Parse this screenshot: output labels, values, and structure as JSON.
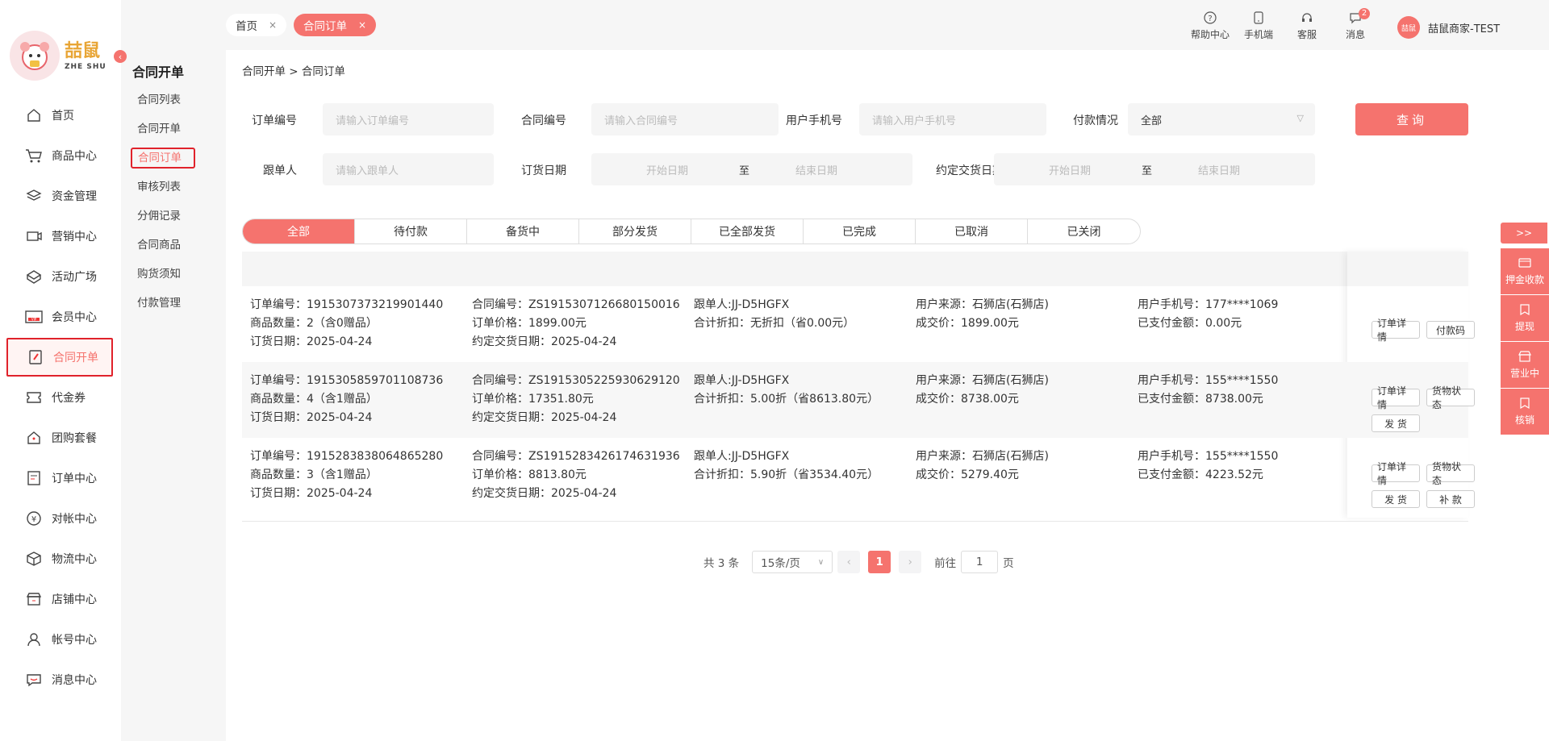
{
  "brand": {
    "name": "喆鼠",
    "sub": "ZHE SHU"
  },
  "sidebar": {
    "items": [
      {
        "label": "首页",
        "icon": "home-icon"
      },
      {
        "label": "商品中心",
        "icon": "cart-icon"
      },
      {
        "label": "资金管理",
        "icon": "layers-icon"
      },
      {
        "label": "营销中心",
        "icon": "marketing-icon"
      },
      {
        "label": "活动广场",
        "icon": "activity-icon"
      },
      {
        "label": "会员中心",
        "icon": "vip-icon"
      },
      {
        "label": "合同开单",
        "icon": "contract-icon"
      },
      {
        "label": "代金券",
        "icon": "coupon-icon"
      },
      {
        "label": "团购套餐",
        "icon": "groupbuy-icon"
      },
      {
        "label": "订单中心",
        "icon": "order-icon"
      },
      {
        "label": "对帐中心",
        "icon": "yen-icon"
      },
      {
        "label": "物流中心",
        "icon": "box-icon"
      },
      {
        "label": "店铺中心",
        "icon": "shop-icon"
      },
      {
        "label": "帐号中心",
        "icon": "user-icon"
      },
      {
        "label": "消息中心",
        "icon": "message-icon"
      }
    ]
  },
  "subnav": {
    "title": "合同开单",
    "items": [
      "合同列表",
      "合同开单",
      "合同订单",
      "审核列表",
      "分佣记录",
      "合同商品",
      "购货须知",
      "付款管理"
    ]
  },
  "tabs": {
    "home": "首页",
    "current": "合同订单",
    "close": "×"
  },
  "topicons": {
    "help": "帮助中心",
    "mobile": "手机端",
    "service": "客服",
    "message": "消息",
    "msg_count": "2"
  },
  "user": {
    "name": "喆鼠商家-TEST",
    "avatar_text": "喆鼠"
  },
  "breadcrumb": "合同开单 > 合同订单",
  "filters": {
    "order_no_label": "订单编号",
    "order_no_ph": "请输入订单编号",
    "contract_no_label": "合同编号",
    "contract_no_ph": "请输入合同编号",
    "phone_label": "用户手机号",
    "phone_ph": "请输入用户手机号",
    "pay_label": "付款情况",
    "pay_value": "全部",
    "follower_label": "跟单人",
    "follower_ph": "请输入跟单人",
    "order_date_label": "订货日期",
    "delivery_date_label": "约定交货日期",
    "start_ph": "开始日期",
    "to": "至",
    "end_ph": "结束日期",
    "query": "查询"
  },
  "status_tabs": [
    "全部",
    "待付款",
    "备货中",
    "部分发货",
    "已全部发货",
    "已完成",
    "已取消",
    "已关闭"
  ],
  "orders": [
    {
      "order_no": "订单编号：1915307373219901440",
      "qty": "商品数量：2（含0赠品）",
      "order_date": "订货日期：2025-04-24",
      "contract_no": "合同编号：ZS1915307126680150016",
      "price": "订单价格：1899.00元",
      "delivery": "约定交货日期：2025-04-24",
      "follower": "跟单人:JJ-D5HGFX",
      "discount": "合计折扣：无折扣（省0.00元）",
      "source": "用户来源：石狮店(石狮店)",
      "deal": "成交价：1899.00元",
      "phone": "用户手机号：177****1069",
      "paid": "已支付金额：0.00元",
      "actions": [
        "订单详情",
        "付款码"
      ]
    },
    {
      "order_no": "订单编号：1915305859701108736",
      "qty": "商品数量：4（含1赠品）",
      "order_date": "订货日期：2025-04-24",
      "contract_no": "合同编号：ZS1915305225930629120",
      "price": "订单价格：17351.80元",
      "delivery": "约定交货日期：2025-04-24",
      "follower": "跟单人:JJ-D5HGFX",
      "discount": "合计折扣：5.00折（省8613.80元）",
      "source": "用户来源：石狮店(石狮店)",
      "deal": "成交价：8738.00元",
      "phone": "用户手机号：155****1550",
      "paid": "已支付金额：8738.00元",
      "actions": [
        "订单详情",
        "货物状态",
        "发 货"
      ]
    },
    {
      "order_no": "订单编号：1915283838064865280",
      "qty": "商品数量：3（含1赠品）",
      "order_date": "订货日期：2025-04-24",
      "contract_no": "合同编号：ZS1915283426174631936",
      "price": "订单价格：8813.80元",
      "delivery": "约定交货日期：2025-04-24",
      "follower": "跟单人:JJ-D5HGFX",
      "discount": "合计折扣：5.90折（省3534.40元）",
      "source": "用户来源：石狮店(石狮店)",
      "deal": "成交价：5279.40元",
      "phone": "用户手机号：155****1550",
      "paid": "已支付金额：4223.52元",
      "actions": [
        "订单详情",
        "货物状态",
        "发 货",
        "补 款"
      ]
    }
  ],
  "pager": {
    "total": "共 3 条",
    "size": "15条/页",
    "page": "1",
    "goto": "前往",
    "goto_value": "1",
    "page_unit": "页"
  },
  "rail": {
    "toggle": ">>",
    "items": [
      "押金收款",
      "提现",
      "营业中",
      "核销"
    ]
  },
  "colors": {
    "accent": "#f5736e",
    "highlight": "#e0222b"
  }
}
